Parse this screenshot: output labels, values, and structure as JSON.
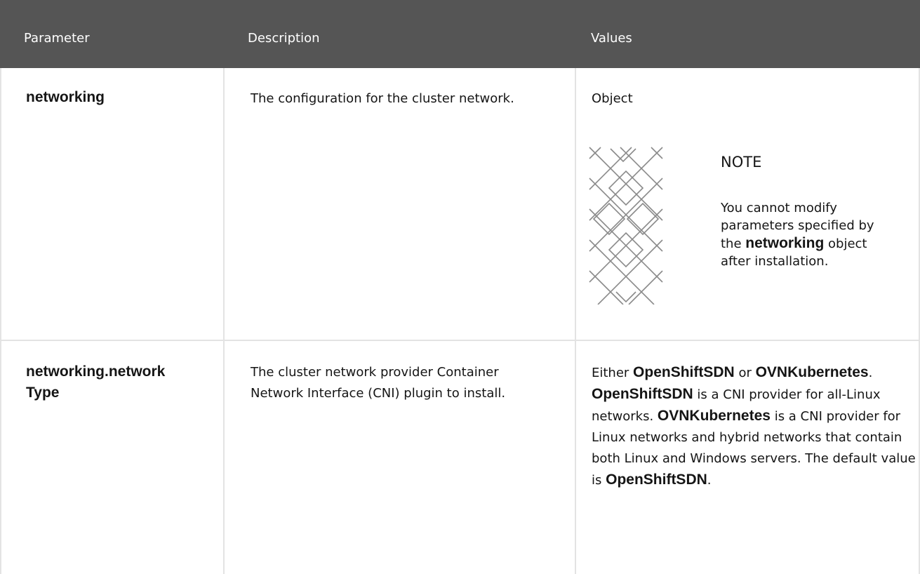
{
  "header": {
    "col_parameter": "Parameter",
    "col_description": "Description",
    "col_values": "Values"
  },
  "rows": [
    {
      "parameter": "networking",
      "description": "The configuration for the cluster network.",
      "value": "Object",
      "note": {
        "title": "NOTE",
        "pre": "You cannot modify parameters specified by the ",
        "code": "networking",
        "post": " object after installation."
      }
    },
    {
      "parameter_line1": "networking.network",
      "parameter_line2": "Type",
      "description": "The cluster network provider Container Network Interface (CNI) plugin to install.",
      "value": {
        "t1": "Either ",
        "c1": "OpenShiftSDN",
        "t2": " or ",
        "c2": "OVNKubernetes",
        "t3": ". ",
        "c3": "OpenShiftSDN",
        "t4": " is a CNI provider for all-Linux networks. ",
        "c4": "OVNKubernetes",
        "t5": " is a CNI provider for Linux networks and hybrid networks that contain both Linux and Windows servers. The default value is ",
        "c5": "OpenShiftSDN",
        "t6": "."
      }
    }
  ],
  "icons": {
    "note_icon": "note-pattern-icon"
  },
  "colors": {
    "header_bg": "#555555",
    "border": "#e3e3e3",
    "text": "#151515"
  }
}
